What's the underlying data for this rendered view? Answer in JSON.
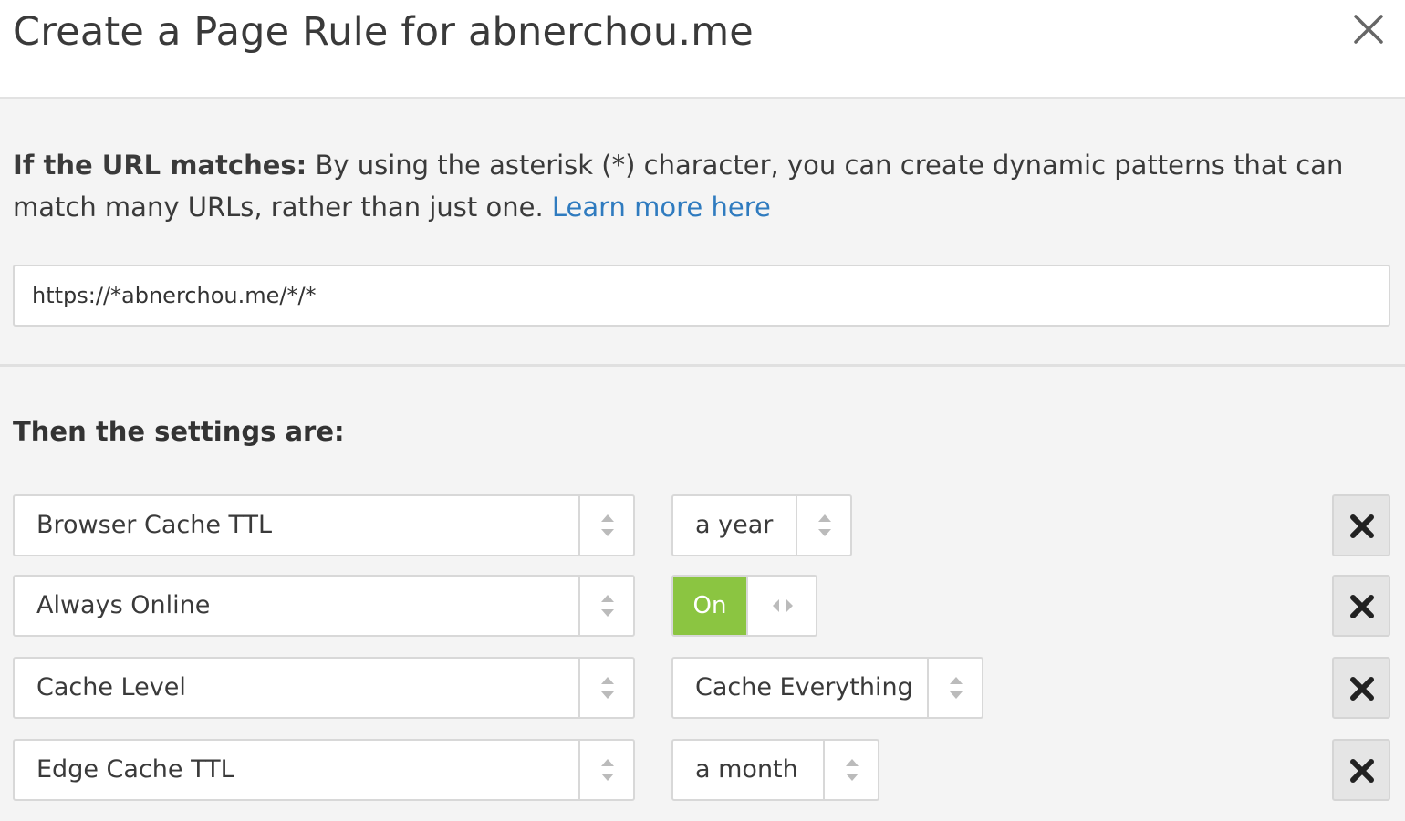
{
  "dialog": {
    "title": "Create a Page Rule for abnerchou.me",
    "close_icon": "close-icon"
  },
  "url_section": {
    "label_bold": "If the URL matches:",
    "description": " By using the asterisk (*) character, you can create dynamic patterns that can match many URLs, rather than just one. ",
    "learn_more": "Learn more here",
    "url_value": "https://*abnerchou.me/*/*",
    "link_color": "#2f7bbf"
  },
  "settings": {
    "heading": "Then the settings are:",
    "rows": [
      {
        "setting": "Browser Cache TTL",
        "value": "a year",
        "remove_icon": "remove-x-icon"
      },
      {
        "setting": "Always Online",
        "value": "On",
        "value_type": "toggle",
        "toggle_color": "#8bc541",
        "remove_icon": "remove-x-icon"
      },
      {
        "setting": "Cache Level",
        "value": "Cache Everything",
        "remove_icon": "remove-x-icon"
      },
      {
        "setting": "Edge Cache TTL",
        "value": "a month",
        "remove_icon": "remove-x-icon"
      }
    ]
  }
}
